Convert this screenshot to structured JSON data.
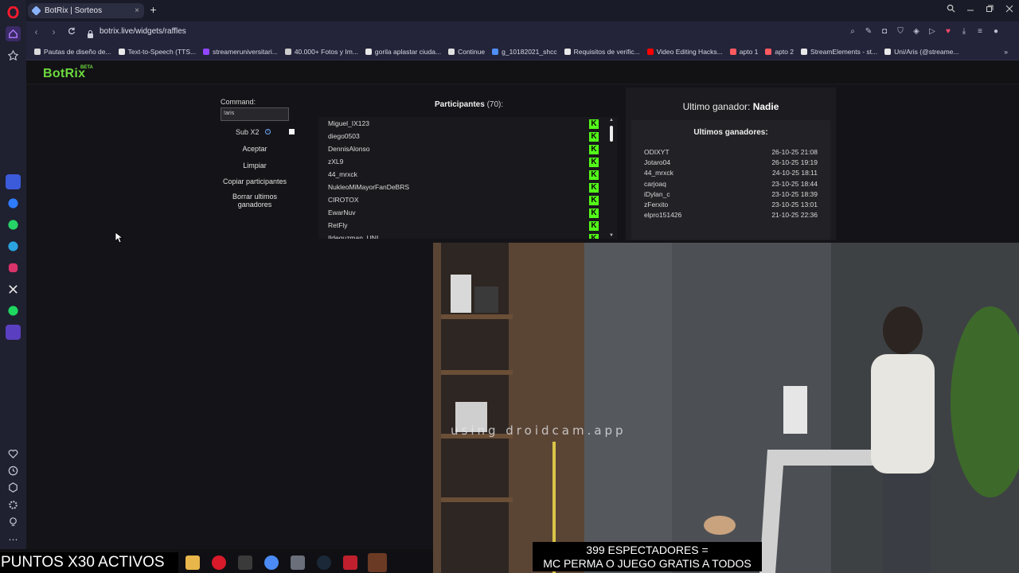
{
  "browser": {
    "tab_title": "BotRix | Sorteos",
    "tab_close": "×",
    "new_tab": "+",
    "url": "botrix.live/widgets/raffles",
    "bookmarks": [
      {
        "label": "Pautas de diseño de...",
        "color": "#d9d9d9"
      },
      {
        "label": "Text-to-Speech (TTS...",
        "color": "#e8e8e8"
      },
      {
        "label": "streameruniversitari...",
        "color": "#9146ff"
      },
      {
        "label": "40.000+ Fotos y Im...",
        "color": "#cccccc"
      },
      {
        "label": "gorila aplastar ciuda...",
        "color": "#e8e8e8"
      },
      {
        "label": "Continue",
        "color": "#e0e0e0"
      },
      {
        "label": "g_10182021_shcc",
        "color": "#4f8ff7"
      },
      {
        "label": "Requisitos de verific...",
        "color": "#e8e8e8"
      },
      {
        "label": "Video Editing Hacks...",
        "color": "#ff0000"
      },
      {
        "label": "apto 1",
        "color": "#ff5a5f"
      },
      {
        "label": "apto 2",
        "color": "#ff5a5f"
      },
      {
        "label": "StreamElements - st...",
        "color": "#e8e8e8"
      },
      {
        "label": "Uni/Aris (@streame...",
        "color": "#e8e8e8"
      }
    ],
    "bookmarks_more": "»"
  },
  "app": {
    "logo": "BotRix",
    "beta": "BETA"
  },
  "controls": {
    "command_label": "Command:",
    "command_value": "!aris",
    "sub_label": "Sub X2",
    "sub_info": "i",
    "accept": "Aceptar",
    "clear": "Limpiar",
    "copy": "Copiar participantes",
    "delete_winners": "Borrar ultimos ganadores"
  },
  "participants": {
    "title": "Participantes",
    "count": "(70):",
    "platform_glyph": "K",
    "names": [
      "Miguel_IX123",
      "diego0503",
      "DennisAlonso",
      "zXL9",
      "44_mrxck",
      "NukleoMiMayorFanDeBRS",
      "CIROTOX",
      "EwarNuv",
      "RetFly",
      "Ildeguzman_UNI"
    ]
  },
  "winners": {
    "last_label": "Ultimo ganador:",
    "last_name": "Nadie",
    "list_title": "Ultimos ganadores:",
    "rows": [
      {
        "name": "ODIXYT",
        "date": "26-10-25 21:08"
      },
      {
        "name": "Jotaro04",
        "date": "26-10-25 19:19"
      },
      {
        "name": "44_mrxck",
        "date": "24-10-25 18:11"
      },
      {
        "name": "carjoaq",
        "date": "23-10-25 18:44"
      },
      {
        "name": "iDylan_c",
        "date": "23-10-25 18:39"
      },
      {
        "name": "zFerxito",
        "date": "23-10-25 13:01"
      },
      {
        "name": "elpro151426",
        "date": "21-10-25 22:36"
      }
    ]
  },
  "stream": {
    "watermark": "using droidcam.app",
    "caption_line1": "399 ESPECTADORES =",
    "caption_line2": "MC PERMA O JUEGO GRATIS A TODOS",
    "puntos": "PUNTOS X30 ACTIVOS"
  }
}
